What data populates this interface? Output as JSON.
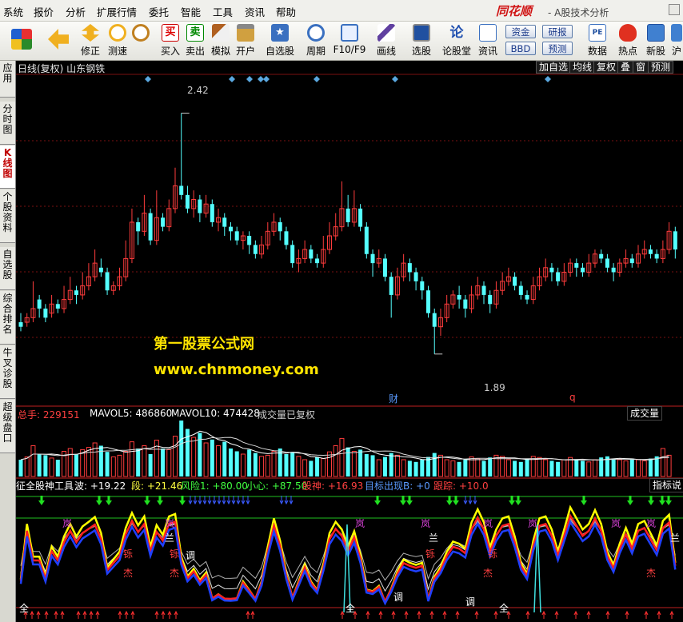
{
  "menu": [
    "系统",
    "报价",
    "分析",
    "扩展行情",
    "委托",
    "智能",
    "工具",
    "资讯",
    "帮助"
  ],
  "brand": {
    "logo": "同花顺",
    "subtitle": "- A股技术分析"
  },
  "toolbar": {
    "buttons": [
      {
        "label": "",
        "icon": "layout-grid-icon"
      },
      {
        "label": "",
        "icon": "back-arrow-icon"
      },
      {
        "label": "修正",
        "icon": "up-down-arrow-icon"
      },
      {
        "label": "测速",
        "icon": "clock-icon"
      },
      {
        "label": "买入",
        "icon": "buy-icon"
      },
      {
        "label": "卖出",
        "icon": "sell-icon"
      },
      {
        "label": "模拟",
        "icon": "gavel-icon"
      },
      {
        "label": "开户",
        "icon": "lock-icon"
      },
      {
        "label": "自选股",
        "icon": "star-icon"
      },
      {
        "label": "周期",
        "icon": "cycle-clock-icon"
      },
      {
        "label": "F10/F9",
        "icon": "f10-icon"
      },
      {
        "label": "画线",
        "icon": "pencil-icon"
      },
      {
        "label": "选股",
        "icon": "monitor-icon"
      },
      {
        "label": "论股堂",
        "icon": "forum-icon"
      },
      {
        "label": "资讯",
        "icon": "news-icon"
      },
      {
        "label": "数据",
        "icon": "pe-data-icon"
      },
      {
        "label": "热点",
        "icon": "hot-icon"
      },
      {
        "label": "新股",
        "icon": "ipo-icon"
      },
      {
        "label": "沪",
        "icon": "sh-icon"
      }
    ],
    "mini": {
      "fund": "资金",
      "bbd": "BBD",
      "research": "研报",
      "forecast": "预测"
    }
  },
  "sidebar": [
    "应用",
    "分时图",
    "K线图",
    "个股资料",
    "自选股",
    "综合排名",
    "牛叉诊股",
    "超级盘口"
  ],
  "chart": {
    "header": "日线(复权) 山东钢铁",
    "buttons": [
      "加自选",
      "均线",
      "复权",
      "叠",
      "窗",
      "预测"
    ],
    "high_label": "2.42",
    "low_label": "1.89",
    "event_cai": "财",
    "event_q": "q",
    "watermark1": "第一股票公式网",
    "watermark2": "www.chnmoney.com",
    "vol": {
      "total_label": "总手: 229151",
      "ma5_label": "MAVOL5: 486860",
      "ma10_label": "MAVOL10: 474428",
      "note": "成交量已复权",
      "panel_btn": "成交量"
    },
    "ind": {
      "name": "征全股神工具",
      "items": [
        "波: +19.22",
        "段: +21.46",
        "风险1: +80.00",
        "小心: +87.50",
        "股神: +16.93",
        "目标出现B: +0",
        "跟踪: +10.0"
      ],
      "panel_btn": "指标说",
      "chars": [
        "岚",
        "兰",
        "铄",
        "杰",
        "调",
        "全"
      ]
    },
    "colors": {
      "up": "#ff3c3c",
      "down": "#54ffff",
      "bg": "#000000"
    }
  },
  "chart_data": {
    "type": "candlestick",
    "ylim": [
      1.8,
      2.5
    ],
    "high": 2.42,
    "low": 1.89,
    "candles": [
      [
        1.96,
        1.95,
        1.98,
        1.94
      ],
      [
        1.96,
        1.97,
        1.98,
        1.95
      ],
      [
        1.97,
        1.99,
        2.05,
        1.96
      ],
      [
        2.01,
        1.99,
        2.02,
        1.97
      ],
      [
        1.99,
        1.97,
        2.0,
        1.96
      ],
      [
        1.98,
        2.0,
        2.02,
        1.97
      ],
      [
        2.0,
        1.99,
        2.01,
        1.98
      ],
      [
        1.99,
        2.01,
        2.04,
        1.98
      ],
      [
        2.01,
        2.03,
        2.06,
        2.0
      ],
      [
        2.03,
        2.02,
        2.04,
        2.0
      ],
      [
        2.02,
        2.04,
        2.07,
        2.01
      ],
      [
        2.04,
        2.06,
        2.09,
        2.03
      ],
      [
        2.06,
        2.09,
        2.12,
        2.05
      ],
      [
        2.08,
        2.07,
        2.1,
        2.06
      ],
      [
        2.07,
        2.03,
        2.08,
        2.02
      ],
      [
        2.03,
        2.04,
        2.05,
        2.02
      ],
      [
        2.04,
        2.06,
        2.08,
        2.03
      ],
      [
        2.06,
        2.1,
        2.14,
        2.05
      ],
      [
        2.1,
        2.18,
        2.21,
        2.09
      ],
      [
        2.18,
        2.16,
        2.19,
        2.13
      ],
      [
        2.16,
        2.2,
        2.24,
        2.15
      ],
      [
        2.2,
        2.14,
        2.21,
        2.13
      ],
      [
        2.14,
        2.19,
        2.25,
        2.13
      ],
      [
        2.19,
        2.17,
        2.2,
        2.16
      ],
      [
        2.17,
        2.21,
        2.23,
        2.16
      ],
      [
        2.21,
        2.26,
        2.3,
        2.2
      ],
      [
        2.26,
        2.24,
        2.42,
        2.23
      ],
      [
        2.24,
        2.21,
        2.26,
        2.2
      ],
      [
        2.21,
        2.23,
        2.25,
        2.19
      ],
      [
        2.23,
        2.2,
        2.24,
        2.18
      ],
      [
        2.2,
        2.22,
        2.24,
        2.19
      ],
      [
        2.22,
        2.18,
        2.23,
        2.17
      ],
      [
        2.18,
        2.19,
        2.21,
        2.16
      ],
      [
        2.19,
        2.17,
        2.2,
        2.15
      ],
      [
        2.17,
        2.16,
        2.18,
        2.14
      ],
      [
        2.16,
        2.14,
        2.17,
        2.13
      ],
      [
        2.14,
        2.15,
        2.16,
        2.12
      ],
      [
        2.15,
        2.13,
        2.16,
        2.11
      ],
      [
        2.13,
        2.11,
        2.14,
        2.1
      ],
      [
        2.11,
        2.13,
        2.15,
        2.1
      ],
      [
        2.13,
        2.16,
        2.18,
        2.12
      ],
      [
        2.16,
        2.18,
        2.2,
        2.15
      ],
      [
        2.18,
        2.16,
        2.19,
        2.14
      ],
      [
        2.16,
        2.13,
        2.17,
        2.12
      ],
      [
        2.13,
        2.09,
        2.14,
        2.08
      ],
      [
        2.09,
        2.1,
        2.12,
        2.07
      ],
      [
        2.1,
        2.12,
        2.14,
        2.09
      ],
      [
        2.12,
        2.1,
        2.13,
        2.09
      ],
      [
        2.1,
        2.09,
        2.11,
        2.08
      ],
      [
        2.09,
        2.12,
        2.15,
        2.08
      ],
      [
        2.12,
        2.15,
        2.18,
        2.11
      ],
      [
        2.15,
        2.17,
        2.2,
        2.14
      ],
      [
        2.17,
        2.21,
        2.27,
        2.16
      ],
      [
        2.21,
        2.18,
        2.24,
        2.17
      ],
      [
        2.18,
        2.21,
        2.25,
        2.17
      ],
      [
        2.21,
        2.17,
        2.22,
        2.16
      ],
      [
        2.17,
        2.11,
        2.18,
        2.1
      ],
      [
        2.11,
        2.09,
        2.12,
        2.06
      ],
      [
        2.09,
        2.1,
        2.12,
        2.08
      ],
      [
        2.1,
        2.06,
        2.11,
        2.05
      ],
      [
        2.06,
        2.02,
        2.07,
        1.97
      ],
      [
        2.02,
        2.06,
        2.08,
        2.01
      ],
      [
        2.06,
        2.09,
        2.11,
        2.05
      ],
      [
        2.09,
        2.07,
        2.1,
        2.05
      ],
      [
        2.07,
        2.05,
        2.08,
        2.03
      ],
      [
        2.05,
        2.03,
        2.06,
        2.01
      ],
      [
        2.03,
        1.98,
        2.04,
        1.97
      ],
      [
        1.98,
        1.95,
        1.99,
        1.89
      ],
      [
        1.95,
        1.97,
        1.99,
        1.93
      ],
      [
        1.97,
        2.0,
        2.02,
        1.96
      ],
      [
        2.0,
        2.02,
        2.03,
        1.99
      ],
      [
        2.02,
        2.01,
        2.04,
        1.99
      ],
      [
        2.01,
        1.99,
        2.02,
        1.97
      ],
      [
        1.99,
        2.02,
        2.04,
        1.98
      ],
      [
        2.02,
        2.04,
        2.06,
        2.01
      ],
      [
        2.04,
        2.02,
        2.05,
        2.0
      ],
      [
        2.02,
        2.0,
        2.03,
        1.98
      ],
      [
        2.0,
        2.03,
        2.05,
        1.99
      ],
      [
        2.03,
        2.05,
        2.07,
        2.02
      ],
      [
        2.05,
        2.06,
        2.08,
        2.04
      ],
      [
        2.06,
        2.04,
        2.07,
        2.03
      ],
      [
        2.04,
        2.02,
        2.05,
        2.01
      ],
      [
        2.02,
        2.01,
        2.03,
        2.0
      ],
      [
        2.01,
        2.04,
        2.06,
        2.0
      ],
      [
        2.04,
        2.06,
        2.08,
        2.03
      ],
      [
        2.06,
        2.08,
        2.1,
        2.05
      ],
      [
        2.08,
        2.07,
        2.09,
        2.05
      ],
      [
        2.07,
        2.05,
        2.08,
        2.04
      ],
      [
        2.05,
        2.07,
        2.09,
        2.04
      ],
      [
        2.07,
        2.09,
        2.1,
        2.06
      ],
      [
        2.09,
        2.08,
        2.1,
        2.06
      ],
      [
        2.08,
        2.07,
        2.09,
        2.06
      ],
      [
        2.07,
        2.09,
        2.11,
        2.06
      ],
      [
        2.09,
        2.11,
        2.12,
        2.08
      ],
      [
        2.11,
        2.1,
        2.12,
        2.09
      ],
      [
        2.1,
        2.08,
        2.11,
        2.07
      ],
      [
        2.08,
        2.07,
        2.09,
        2.05
      ],
      [
        2.07,
        2.09,
        2.1,
        2.06
      ],
      [
        2.09,
        2.1,
        2.12,
        2.08
      ],
      [
        2.1,
        2.09,
        2.11,
        2.08
      ],
      [
        2.09,
        2.11,
        2.13,
        2.08
      ],
      [
        2.11,
        2.12,
        2.14,
        2.1
      ],
      [
        2.12,
        2.11,
        2.13,
        2.1
      ],
      [
        2.11,
        2.1,
        2.12,
        2.09
      ],
      [
        2.1,
        2.12,
        2.14,
        2.09
      ],
      [
        2.12,
        2.16,
        2.18,
        2.11
      ],
      [
        2.16,
        2.12,
        2.17,
        2.1
      ]
    ],
    "volume": [
      0.3,
      0.35,
      0.55,
      0.4,
      0.38,
      0.33,
      0.3,
      0.45,
      0.5,
      0.4,
      0.48,
      0.52,
      0.6,
      0.55,
      0.44,
      0.35,
      0.38,
      0.45,
      0.62,
      0.5,
      0.55,
      0.4,
      0.65,
      0.5,
      0.48,
      0.72,
      1.0,
      0.85,
      0.7,
      0.78,
      0.6,
      0.66,
      0.55,
      0.62,
      0.5,
      0.45,
      0.4,
      0.48,
      0.42,
      0.36,
      0.38,
      0.45,
      0.5,
      0.4,
      0.44,
      0.36,
      0.3,
      0.28,
      0.35,
      0.32,
      0.44,
      0.55,
      0.68,
      0.52,
      0.45,
      0.48,
      0.4,
      0.38,
      0.3,
      0.35,
      0.42,
      0.38,
      0.3,
      0.28,
      0.26,
      0.3,
      0.35,
      0.42,
      0.38,
      0.3,
      0.28,
      0.26,
      0.3,
      0.35,
      0.32,
      0.28,
      0.34,
      0.38,
      0.36,
      0.3,
      0.28,
      0.26,
      0.32,
      0.36,
      0.34,
      0.3,
      0.28,
      0.26,
      0.3,
      0.34,
      0.3,
      0.28,
      0.26,
      0.3,
      0.34,
      0.36,
      0.32,
      0.3,
      0.28,
      0.32,
      0.3,
      0.28,
      0.32,
      0.36,
      0.5,
      0.38
    ]
  }
}
